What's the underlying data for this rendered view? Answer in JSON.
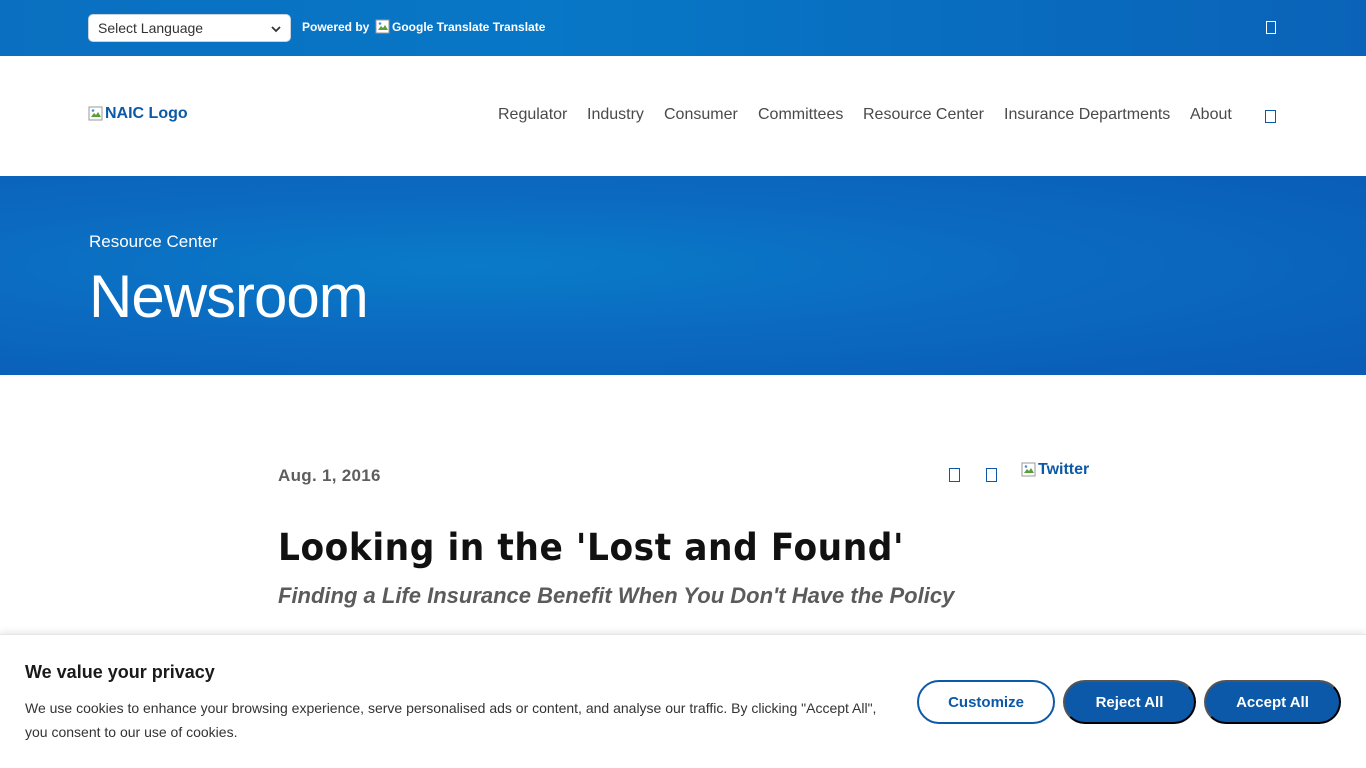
{
  "translate_bar": {
    "language_select": "Select Language",
    "powered_by": "Powered by",
    "google_translate_link": "Google Translate Translate"
  },
  "header": {
    "logo_alt": "NAIC Logo",
    "nav": [
      {
        "label": "Regulator"
      },
      {
        "label": "Industry"
      },
      {
        "label": "Consumer"
      },
      {
        "label": "Committees"
      },
      {
        "label": "Resource Center"
      },
      {
        "label": "Insurance Departments"
      },
      {
        "label": "About"
      }
    ]
  },
  "hero": {
    "section": "Resource Center",
    "title": "Newsroom"
  },
  "article": {
    "date": "Aug. 1, 2016",
    "twitter_alt": "Twitter",
    "title": "Looking in the 'Lost and Found'",
    "subtitle": "Finding a Life Insurance Benefit When You Don't Have the Policy"
  },
  "cookie_banner": {
    "title": "We value your privacy",
    "text": "We use cookies to enhance your browsing experience, serve personalised ads or content, and analyse our traffic. By clicking \"Accept All\", you consent to our use of cookies.",
    "customize": "Customize",
    "reject_all": "Reject All",
    "accept_all": "Accept All"
  },
  "colors": {
    "brand_blue": "#0b59a8",
    "hero_blue": "#0a6bc0"
  }
}
